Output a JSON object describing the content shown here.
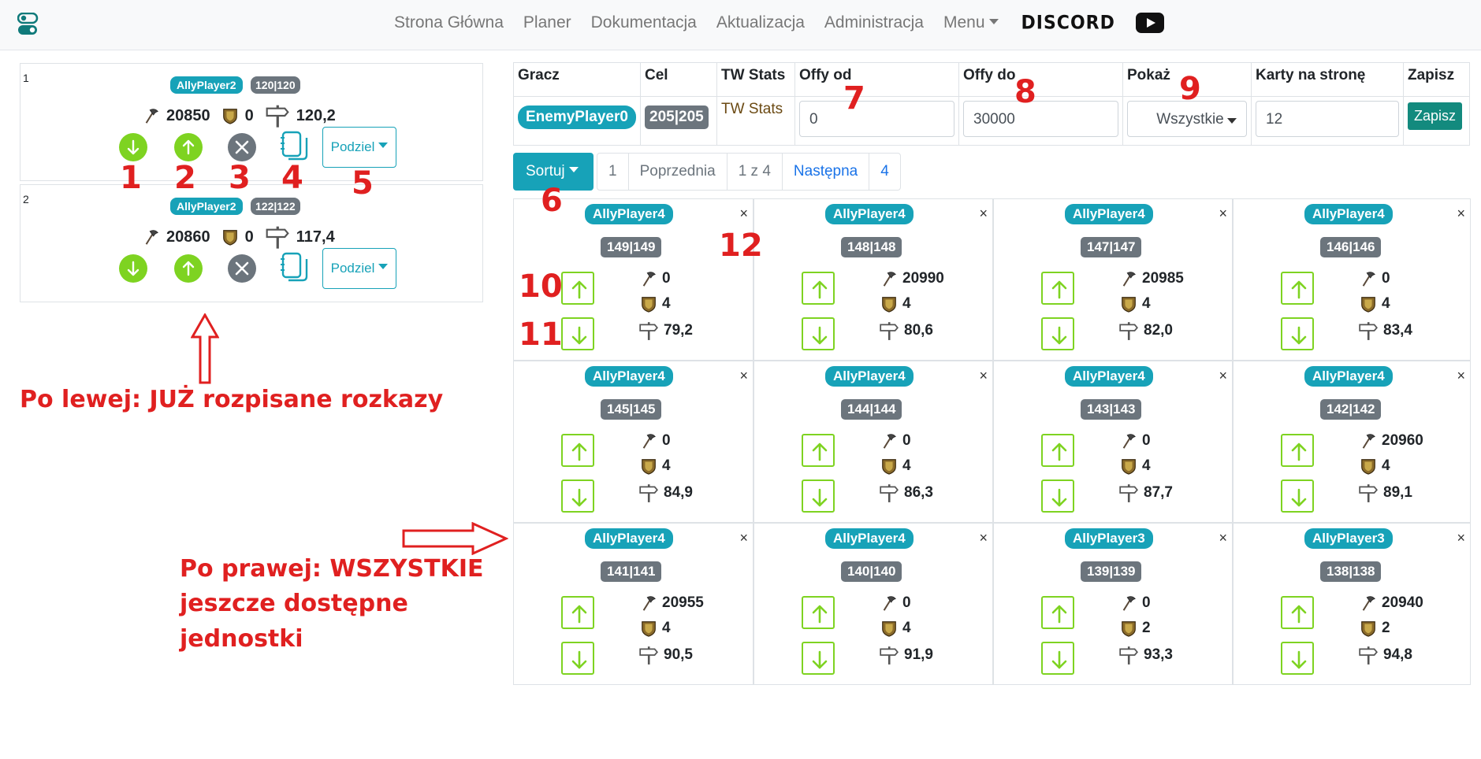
{
  "nav": {
    "links": [
      "Strona Główna",
      "Planer",
      "Dokumentacja",
      "Aktualizacja",
      "Administracja"
    ],
    "menu_label": "Menu",
    "discord_label": "DISCORD",
    "icons": [
      "logo-toggle-icon",
      "youtube-icon"
    ]
  },
  "left_orders": [
    {
      "index": "1",
      "player": "AllyPlayer2",
      "coord": "120|120",
      "axe": "20850",
      "shield": "0",
      "distance": "120,2",
      "split_label": "Podziel"
    },
    {
      "index": "2",
      "player": "AllyPlayer2",
      "coord": "122|122",
      "axe": "20860",
      "shield": "0",
      "distance": "117,4",
      "split_label": "Podziel"
    }
  ],
  "controls": {
    "headers": [
      "Gracz",
      "Cel",
      "TW Stats",
      "Offy od",
      "Offy do",
      "Pokaż",
      "Karty na stronę",
      "Zapisz"
    ],
    "player": "EnemyPlayer0",
    "target": "205|205",
    "tw_stats": "TW Stats",
    "offy_od": "0",
    "offy_do": "30000",
    "pokaz": "Wszystkie",
    "per_page": "12",
    "save": "Zapisz"
  },
  "sort_label": "Sortuj",
  "pager": {
    "first": "1",
    "prev": "Poprzednia",
    "info": "1 z 4",
    "next": "Następna",
    "last": "4"
  },
  "units": [
    {
      "player": "AllyPlayer4",
      "coord": "149|149",
      "axe": "0",
      "shield": "4",
      "distance": "79,2"
    },
    {
      "player": "AllyPlayer4",
      "coord": "148|148",
      "axe": "20990",
      "shield": "4",
      "distance": "80,6"
    },
    {
      "player": "AllyPlayer4",
      "coord": "147|147",
      "axe": "20985",
      "shield": "4",
      "distance": "82,0"
    },
    {
      "player": "AllyPlayer4",
      "coord": "146|146",
      "axe": "0",
      "shield": "4",
      "distance": "83,4"
    },
    {
      "player": "AllyPlayer4",
      "coord": "145|145",
      "axe": "0",
      "shield": "4",
      "distance": "84,9"
    },
    {
      "player": "AllyPlayer4",
      "coord": "144|144",
      "axe": "0",
      "shield": "4",
      "distance": "86,3"
    },
    {
      "player": "AllyPlayer4",
      "coord": "143|143",
      "axe": "0",
      "shield": "4",
      "distance": "87,7"
    },
    {
      "player": "AllyPlayer4",
      "coord": "142|142",
      "axe": "20960",
      "shield": "4",
      "distance": "89,1"
    },
    {
      "player": "AllyPlayer4",
      "coord": "141|141",
      "axe": "20955",
      "shield": "4",
      "distance": "90,5"
    },
    {
      "player": "AllyPlayer4",
      "coord": "140|140",
      "axe": "0",
      "shield": "4",
      "distance": "91,9"
    },
    {
      "player": "AllyPlayer3",
      "coord": "139|139",
      "axe": "0",
      "shield": "2",
      "distance": "93,3"
    },
    {
      "player": "AllyPlayer3",
      "coord": "138|138",
      "axe": "20940",
      "shield": "2",
      "distance": "94,8"
    }
  ],
  "close_glyph": "×",
  "annotations": {
    "numbers": [
      "1",
      "2",
      "3",
      "4",
      "5",
      "6",
      "7",
      "8",
      "9",
      "10",
      "11",
      "12"
    ],
    "left_note": "Po lewej: JUŻ rozpisane rozkazy",
    "right_note": [
      "Po prawej: WSZYSTKIE",
      "jeszcze dostępne",
      "jednostki"
    ]
  },
  "colors": {
    "accent": "#17a2b8",
    "green": "#7ed321",
    "secondary": "#6c757d",
    "annotation": "#e02020",
    "save": "#138a7e"
  }
}
